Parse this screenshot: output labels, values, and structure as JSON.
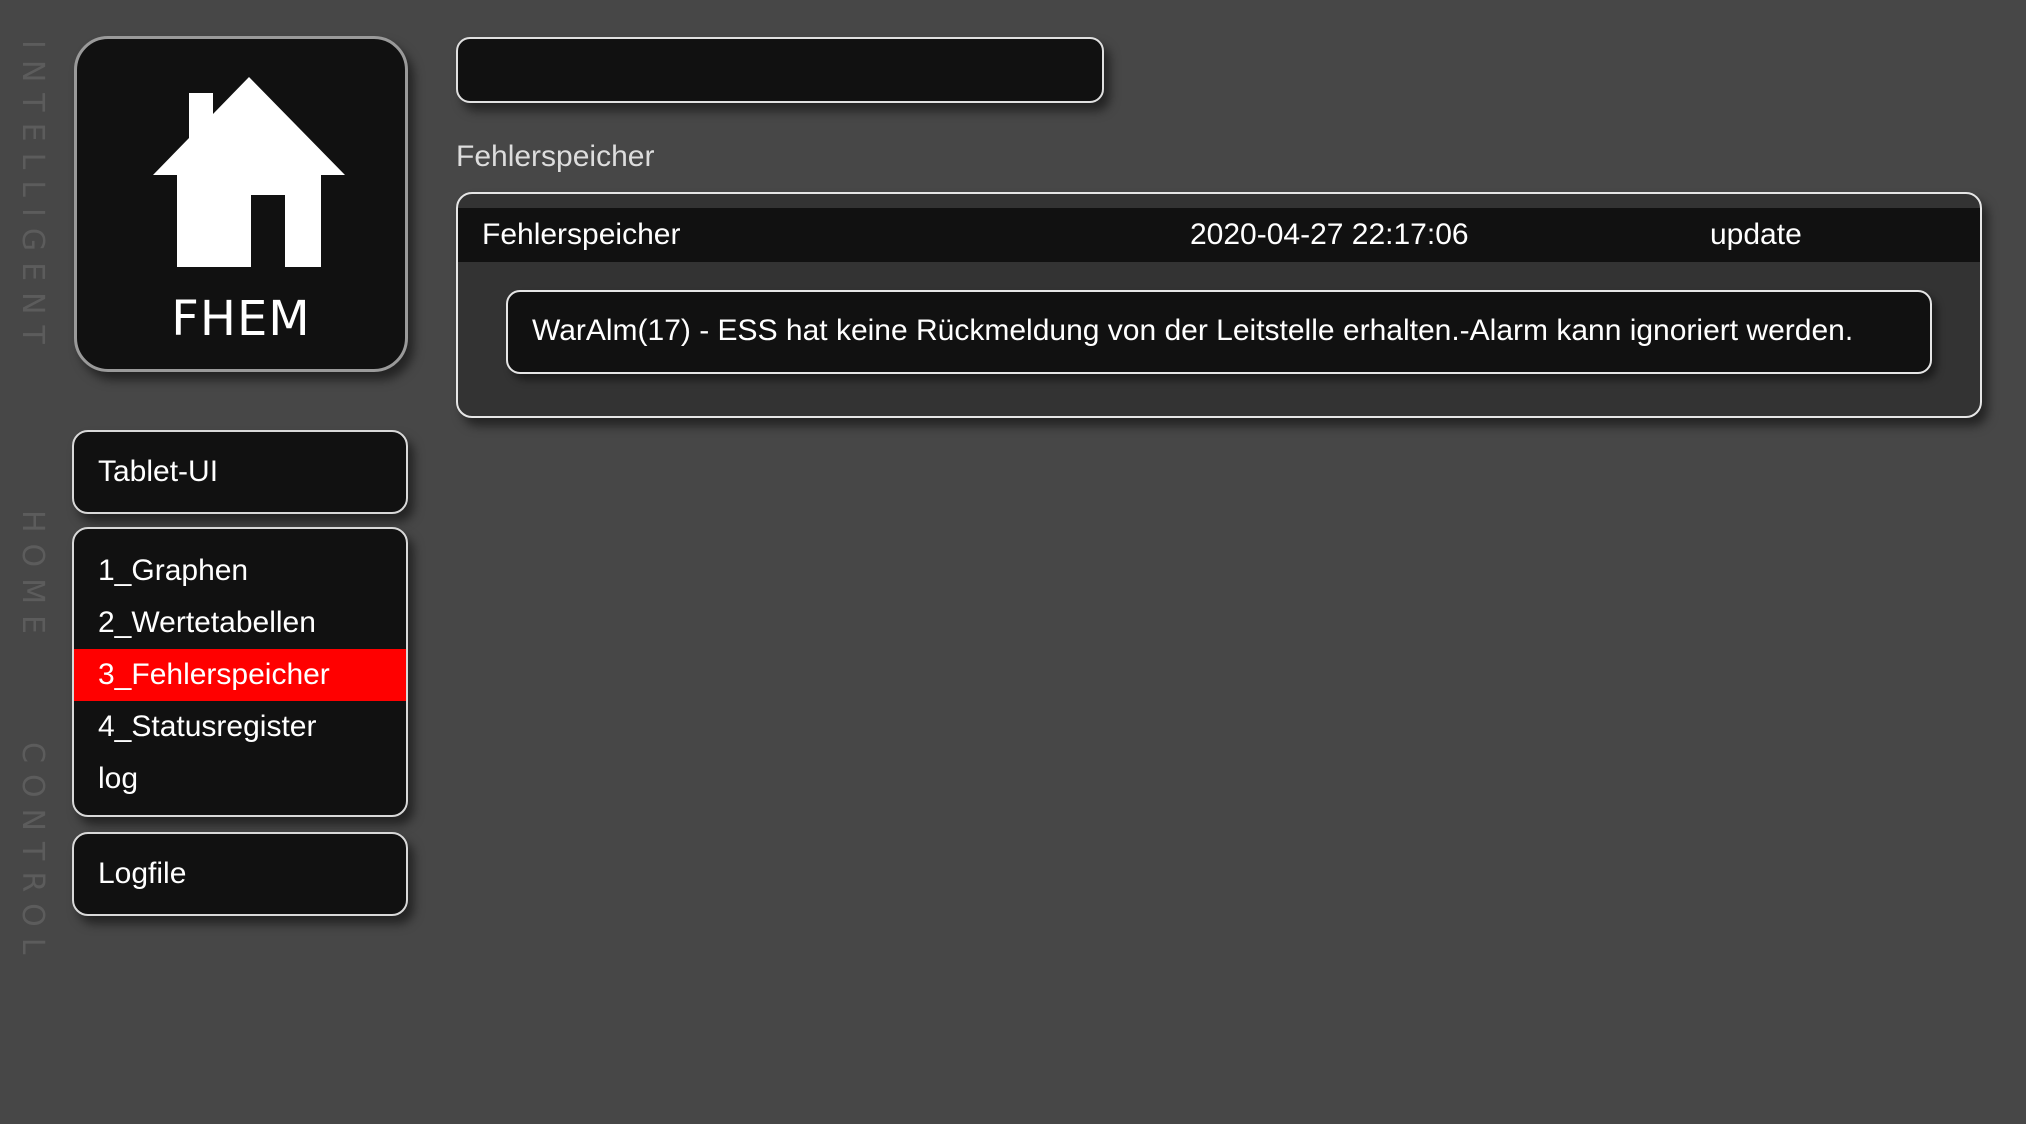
{
  "slogan": {
    "word1": "INTELLIGENT",
    "word2": "HOME",
    "word3": "CONTROL"
  },
  "logo": {
    "icon": "house-icon",
    "text": "FHEM"
  },
  "sidebar": {
    "top_item": {
      "label": "Tablet-UI"
    },
    "rooms": [
      {
        "label": "1_Graphen",
        "active": false
      },
      {
        "label": "2_Wertetabellen",
        "active": false
      },
      {
        "label": "3_Fehlerspeicher",
        "active": true
      },
      {
        "label": "4_Statusregister",
        "active": false
      },
      {
        "label": "log",
        "active": false
      }
    ],
    "bottom_item": {
      "label": "Logfile"
    }
  },
  "search": {
    "value": ""
  },
  "main": {
    "section_title": "Fehlerspeicher",
    "device": {
      "name": "Fehlerspeicher",
      "timestamp": "2020-04-27 22:17:06",
      "state_link": "update",
      "message": "WarAlm(17) - ESS hat keine Rückmeldung von der Leitstelle erhalten.-Alarm kann ignoriert werden."
    }
  },
  "colors": {
    "background": "#474747",
    "panel": "#111111",
    "active_highlight": "#ff0000",
    "border": "#e6e6e6"
  }
}
